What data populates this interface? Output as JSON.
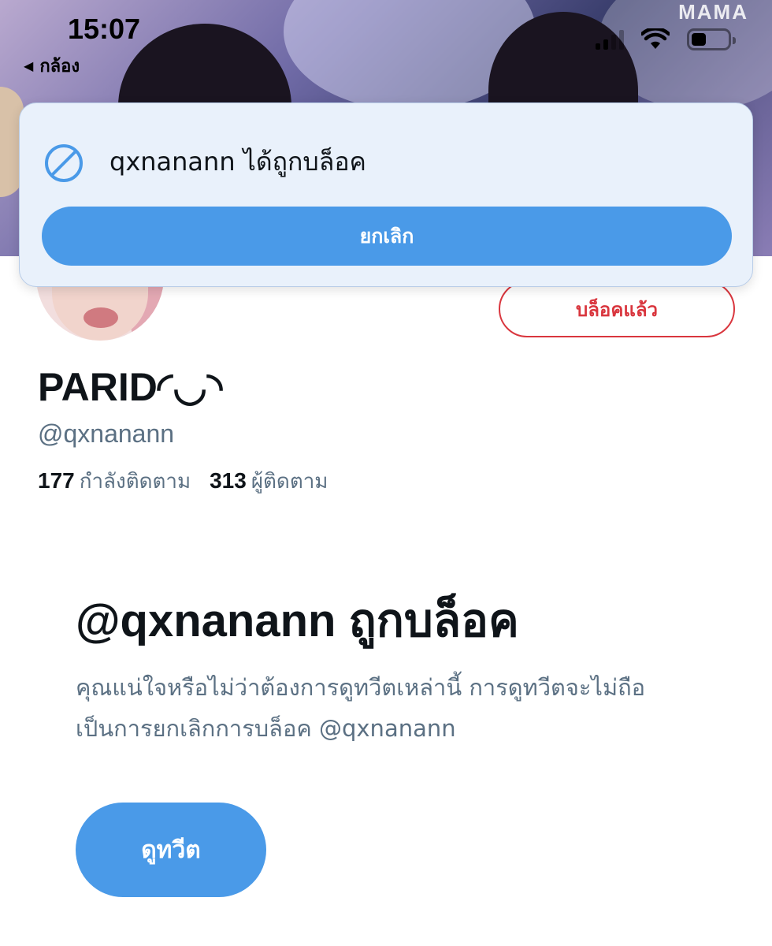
{
  "status_bar": {
    "time": "15:07",
    "back_app_label": "กล้อง",
    "battery_level": 0.4
  },
  "banner": {
    "logo_text": "MAMA"
  },
  "toast": {
    "message": "qxnanann ได้ถูกบล็อค",
    "undo_label": "ยกเลิก"
  },
  "profile": {
    "blocked_button_label": "บล็อคแล้ว",
    "display_name": "PARID◜◡◝",
    "handle": "@qxnanann",
    "following_count": "177",
    "following_label": "กำลังติดตาม",
    "followers_count": "313",
    "followers_label": "ผู้ติดตาม"
  },
  "blocked_notice": {
    "title": "@qxnanann ถูกบล็อค",
    "description": "คุณแน่ใจหรือไม่ว่าต้องการดูทวีตเหล่านี้ การดูทวีตจะไม่ถือเป็นการยกเลิกการบล็อค @qxnanann",
    "view_tweets_label": "ดูทวีต"
  },
  "colors": {
    "accent_blue": "#4a9ae8",
    "blocked_red": "#d9363e",
    "toast_bg": "#e9f1fb",
    "secondary_text": "#5b7083"
  }
}
